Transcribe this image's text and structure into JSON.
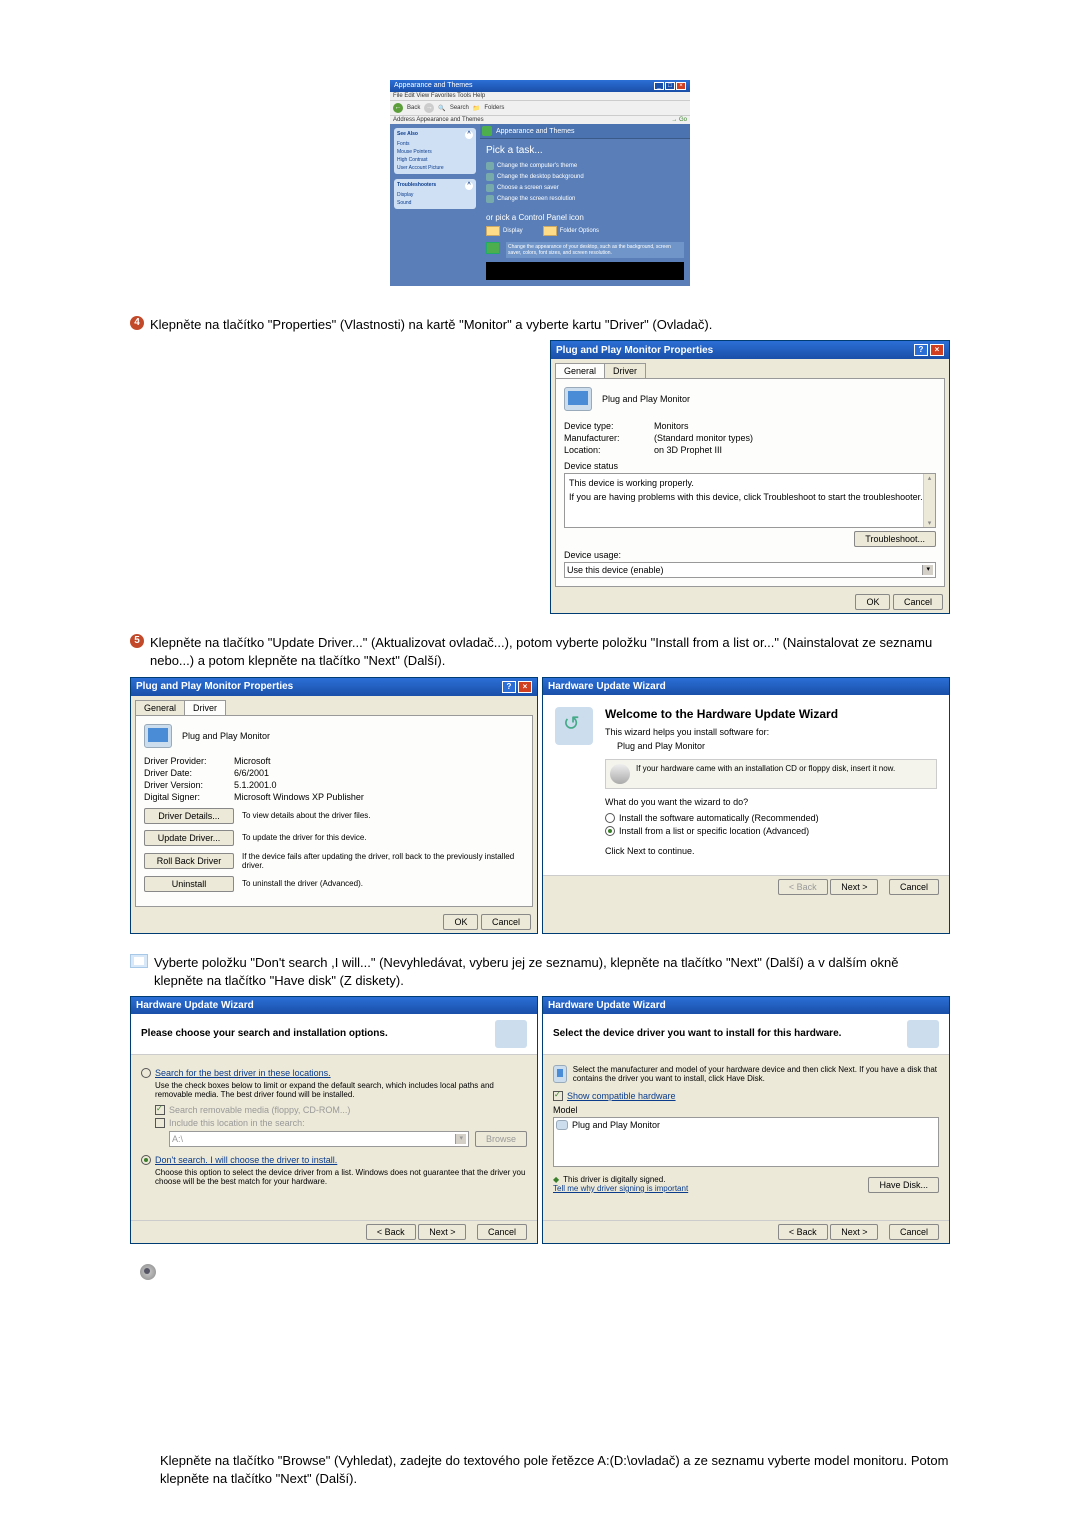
{
  "cp": {
    "title": "Appearance and Themes",
    "menu": "File  Edit  View  Favorites  Tools  Help",
    "back": "Back",
    "search": "Search",
    "folders": "Folders",
    "address": "Address  Appearance and Themes",
    "go": "Go",
    "sidebox1_hdr": "See Also",
    "sidebox1_items": [
      "Fonts",
      "Mouse Pointers",
      "High Contrast",
      "User Account Picture"
    ],
    "sidebox2_hdr": "Troubleshooters",
    "sidebox2_items": [
      "Display",
      "Sound"
    ],
    "main_hdr": "Appearance and Themes",
    "pick_task": "Pick a task...",
    "tasks": [
      "Change the computer's theme",
      "Change the desktop background",
      "Choose a screen saver",
      "Change the screen resolution"
    ],
    "pick_icon": "or pick a Control Panel icon",
    "icon1": "Display",
    "icon2": "Folder Options",
    "desc": "Change the appearance of your desktop, such as the background, screen saver, colors, font sizes, and screen resolution."
  },
  "step4": "Klepněte na tlačítko \"Properties\" (Vlastnosti) na kartě \"Monitor\" a vyberte kartu \"Driver\" (Ovladač).",
  "dlg_general": {
    "title": "Plug and Play Monitor Properties",
    "tab_general": "General",
    "tab_driver": "Driver",
    "device_name": "Plug and Play Monitor",
    "device_type_k": "Device type:",
    "device_type_v": "Monitors",
    "manufacturer_k": "Manufacturer:",
    "manufacturer_v": "(Standard monitor types)",
    "location_k": "Location:",
    "location_v": "on 3D Prophet III",
    "status_label": "Device status",
    "status_line1": "This device is working properly.",
    "status_line2": "If you are having problems with this device, click Troubleshoot to start the troubleshooter.",
    "troubleshoot": "Troubleshoot...",
    "usage_label": "Device usage:",
    "usage_value": "Use this device (enable)",
    "ok": "OK",
    "cancel": "Cancel"
  },
  "step5": "Klepněte na tlačítko \"Update Driver...\" (Aktualizovat ovladač...), potom vyberte položku \"Install from a list or...\" (Nainstalovat ze seznamu nebo...) a potom klepněte na tlačítko \"Next\" (Další).",
  "dlg_driver": {
    "title": "Plug and Play Monitor Properties",
    "tab_general": "General",
    "tab_driver": "Driver",
    "device_name": "Plug and Play Monitor",
    "provider_k": "Driver Provider:",
    "provider_v": "Microsoft",
    "date_k": "Driver Date:",
    "date_v": "6/6/2001",
    "version_k": "Driver Version:",
    "version_v": "5.1.2001.0",
    "signer_k": "Digital Signer:",
    "signer_v": "Microsoft Windows XP Publisher",
    "details_btn": "Driver Details...",
    "details_desc": "To view details about the driver files.",
    "update_btn": "Update Driver...",
    "update_desc": "To update the driver for this device.",
    "rollback_btn": "Roll Back Driver",
    "rollback_desc": "If the device fails after updating the driver, roll back to the previously installed driver.",
    "uninstall_btn": "Uninstall",
    "uninstall_desc": "To uninstall the driver (Advanced).",
    "ok": "OK",
    "cancel": "Cancel"
  },
  "wiz1": {
    "title": "Hardware Update Wizard",
    "welcome": "Welcome to the Hardware Update Wizard",
    "helps": "This wizard helps you install software for:",
    "device": "Plug and Play Monitor",
    "cd_text": "If your hardware came with an installation CD or floppy disk, insert it now.",
    "what": "What do you want the wizard to do?",
    "opt_auto": "Install the software automatically (Recommended)",
    "opt_list": "Install from a list or specific location (Advanced)",
    "click_next": "Click Next to continue.",
    "back": "< Back",
    "next": "Next >",
    "cancel": "Cancel"
  },
  "step6": "Vyberte položku \"Don't search ,I will...\" (Nevyhledávat, vyberu jej ze seznamu), klepněte na tlačítko \"Next\" (Další) a v dalším okně klepněte na tlačítko \"Have disk\" (Z diskety).",
  "wiz2": {
    "title": "Hardware Update Wizard",
    "header": "Please choose your search and installation options.",
    "opt_search": "Search for the best driver in these locations.",
    "opt_search_desc": "Use the check boxes below to limit or expand the default search, which includes local paths and removable media. The best driver found will be installed.",
    "chk_media": "Search removable media (floppy, CD-ROM...)",
    "chk_include": "Include this location in the search:",
    "path": "A:\\",
    "browse": "Browse",
    "opt_dont": "Don't search. I will choose the driver to install.",
    "opt_dont_desc": "Choose this option to select the device driver from a list. Windows does not guarantee that the driver you choose will be the best match for your hardware.",
    "back": "< Back",
    "next": "Next >",
    "cancel": "Cancel"
  },
  "wiz3": {
    "title": "Hardware Update Wizard",
    "header": "Select the device driver you want to install for this hardware.",
    "instruction": "Select the manufacturer and model of your hardware device and then click Next. If you have a disk that contains the driver you want to install, click Have Disk.",
    "chk_compat": "Show compatible hardware",
    "model": "Model",
    "model_item": "Plug and Play Monitor",
    "signed": "This driver is digitally signed.",
    "tell_me": "Tell me why driver signing is important",
    "have_disk": "Have Disk...",
    "back": "< Back",
    "next": "Next >",
    "cancel": "Cancel"
  },
  "bottom": "Klepněte na tlačítko \"Browse\" (Vyhledat), zadejte do textového pole řetězce A:(D:\\ovladač) a ze seznamu vyberte model monitoru. Potom klepněte na tlačítko \"Next\" (Další)."
}
